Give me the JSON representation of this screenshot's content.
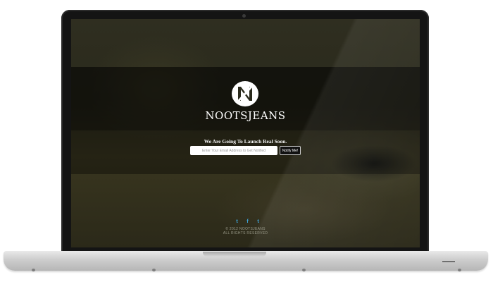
{
  "brand": {
    "name": "NOOTSJEANS",
    "logo_icon": "nootsjeans-logo-icon"
  },
  "hero": {
    "tagline": "We Are Going To Launch Real Soon."
  },
  "signup": {
    "email_placeholder": "Enter Your Email Address to Get Notified",
    "email_value": "",
    "button_label": "Notify Me!"
  },
  "social": {
    "icons": [
      "twitter-icon",
      "facebook-icon",
      "tumblr-icon"
    ],
    "labels": [
      "t",
      "f",
      "t"
    ]
  },
  "footer": {
    "line1": "© 2012 NOOTSJEANS",
    "line2": "ALL RIGHTS RESERVED"
  },
  "colors": {
    "social_accent": "#3fa9e0",
    "screen_base": "#2f2e20"
  }
}
